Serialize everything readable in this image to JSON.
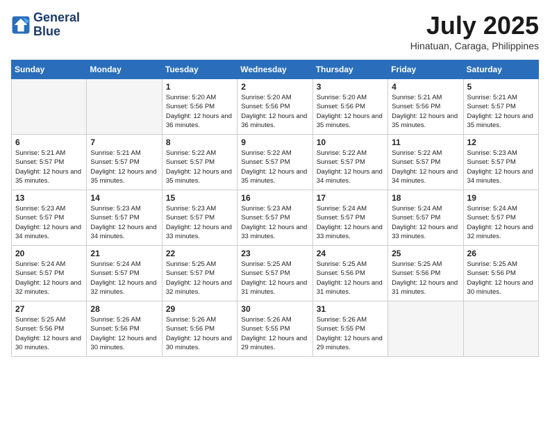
{
  "header": {
    "logo_line1": "General",
    "logo_line2": "Blue",
    "month": "July 2025",
    "location": "Hinatuan, Caraga, Philippines"
  },
  "weekdays": [
    "Sunday",
    "Monday",
    "Tuesday",
    "Wednesday",
    "Thursday",
    "Friday",
    "Saturday"
  ],
  "weeks": [
    [
      {
        "num": "",
        "empty": true
      },
      {
        "num": "",
        "empty": true
      },
      {
        "num": "1",
        "sunrise": "Sunrise: 5:20 AM",
        "sunset": "Sunset: 5:56 PM",
        "daylight": "Daylight: 12 hours and 36 minutes."
      },
      {
        "num": "2",
        "sunrise": "Sunrise: 5:20 AM",
        "sunset": "Sunset: 5:56 PM",
        "daylight": "Daylight: 12 hours and 36 minutes."
      },
      {
        "num": "3",
        "sunrise": "Sunrise: 5:20 AM",
        "sunset": "Sunset: 5:56 PM",
        "daylight": "Daylight: 12 hours and 35 minutes."
      },
      {
        "num": "4",
        "sunrise": "Sunrise: 5:21 AM",
        "sunset": "Sunset: 5:56 PM",
        "daylight": "Daylight: 12 hours and 35 minutes."
      },
      {
        "num": "5",
        "sunrise": "Sunrise: 5:21 AM",
        "sunset": "Sunset: 5:57 PM",
        "daylight": "Daylight: 12 hours and 35 minutes."
      }
    ],
    [
      {
        "num": "6",
        "sunrise": "Sunrise: 5:21 AM",
        "sunset": "Sunset: 5:57 PM",
        "daylight": "Daylight: 12 hours and 35 minutes."
      },
      {
        "num": "7",
        "sunrise": "Sunrise: 5:21 AM",
        "sunset": "Sunset: 5:57 PM",
        "daylight": "Daylight: 12 hours and 35 minutes."
      },
      {
        "num": "8",
        "sunrise": "Sunrise: 5:22 AM",
        "sunset": "Sunset: 5:57 PM",
        "daylight": "Daylight: 12 hours and 35 minutes."
      },
      {
        "num": "9",
        "sunrise": "Sunrise: 5:22 AM",
        "sunset": "Sunset: 5:57 PM",
        "daylight": "Daylight: 12 hours and 35 minutes."
      },
      {
        "num": "10",
        "sunrise": "Sunrise: 5:22 AM",
        "sunset": "Sunset: 5:57 PM",
        "daylight": "Daylight: 12 hours and 34 minutes."
      },
      {
        "num": "11",
        "sunrise": "Sunrise: 5:22 AM",
        "sunset": "Sunset: 5:57 PM",
        "daylight": "Daylight: 12 hours and 34 minutes."
      },
      {
        "num": "12",
        "sunrise": "Sunrise: 5:23 AM",
        "sunset": "Sunset: 5:57 PM",
        "daylight": "Daylight: 12 hours and 34 minutes."
      }
    ],
    [
      {
        "num": "13",
        "sunrise": "Sunrise: 5:23 AM",
        "sunset": "Sunset: 5:57 PM",
        "daylight": "Daylight: 12 hours and 34 minutes."
      },
      {
        "num": "14",
        "sunrise": "Sunrise: 5:23 AM",
        "sunset": "Sunset: 5:57 PM",
        "daylight": "Daylight: 12 hours and 34 minutes."
      },
      {
        "num": "15",
        "sunrise": "Sunrise: 5:23 AM",
        "sunset": "Sunset: 5:57 PM",
        "daylight": "Daylight: 12 hours and 33 minutes."
      },
      {
        "num": "16",
        "sunrise": "Sunrise: 5:23 AM",
        "sunset": "Sunset: 5:57 PM",
        "daylight": "Daylight: 12 hours and 33 minutes."
      },
      {
        "num": "17",
        "sunrise": "Sunrise: 5:24 AM",
        "sunset": "Sunset: 5:57 PM",
        "daylight": "Daylight: 12 hours and 33 minutes."
      },
      {
        "num": "18",
        "sunrise": "Sunrise: 5:24 AM",
        "sunset": "Sunset: 5:57 PM",
        "daylight": "Daylight: 12 hours and 33 minutes."
      },
      {
        "num": "19",
        "sunrise": "Sunrise: 5:24 AM",
        "sunset": "Sunset: 5:57 PM",
        "daylight": "Daylight: 12 hours and 32 minutes."
      }
    ],
    [
      {
        "num": "20",
        "sunrise": "Sunrise: 5:24 AM",
        "sunset": "Sunset: 5:57 PM",
        "daylight": "Daylight: 12 hours and 32 minutes."
      },
      {
        "num": "21",
        "sunrise": "Sunrise: 5:24 AM",
        "sunset": "Sunset: 5:57 PM",
        "daylight": "Daylight: 12 hours and 32 minutes."
      },
      {
        "num": "22",
        "sunrise": "Sunrise: 5:25 AM",
        "sunset": "Sunset: 5:57 PM",
        "daylight": "Daylight: 12 hours and 32 minutes."
      },
      {
        "num": "23",
        "sunrise": "Sunrise: 5:25 AM",
        "sunset": "Sunset: 5:57 PM",
        "daylight": "Daylight: 12 hours and 31 minutes."
      },
      {
        "num": "24",
        "sunrise": "Sunrise: 5:25 AM",
        "sunset": "Sunset: 5:56 PM",
        "daylight": "Daylight: 12 hours and 31 minutes."
      },
      {
        "num": "25",
        "sunrise": "Sunrise: 5:25 AM",
        "sunset": "Sunset: 5:56 PM",
        "daylight": "Daylight: 12 hours and 31 minutes."
      },
      {
        "num": "26",
        "sunrise": "Sunrise: 5:25 AM",
        "sunset": "Sunset: 5:56 PM",
        "daylight": "Daylight: 12 hours and 30 minutes."
      }
    ],
    [
      {
        "num": "27",
        "sunrise": "Sunrise: 5:25 AM",
        "sunset": "Sunset: 5:56 PM",
        "daylight": "Daylight: 12 hours and 30 minutes."
      },
      {
        "num": "28",
        "sunrise": "Sunrise: 5:26 AM",
        "sunset": "Sunset: 5:56 PM",
        "daylight": "Daylight: 12 hours and 30 minutes."
      },
      {
        "num": "29",
        "sunrise": "Sunrise: 5:26 AM",
        "sunset": "Sunset: 5:56 PM",
        "daylight": "Daylight: 12 hours and 30 minutes."
      },
      {
        "num": "30",
        "sunrise": "Sunrise: 5:26 AM",
        "sunset": "Sunset: 5:55 PM",
        "daylight": "Daylight: 12 hours and 29 minutes."
      },
      {
        "num": "31",
        "sunrise": "Sunrise: 5:26 AM",
        "sunset": "Sunset: 5:55 PM",
        "daylight": "Daylight: 12 hours and 29 minutes."
      },
      {
        "num": "",
        "empty": true
      },
      {
        "num": "",
        "empty": true
      }
    ]
  ]
}
